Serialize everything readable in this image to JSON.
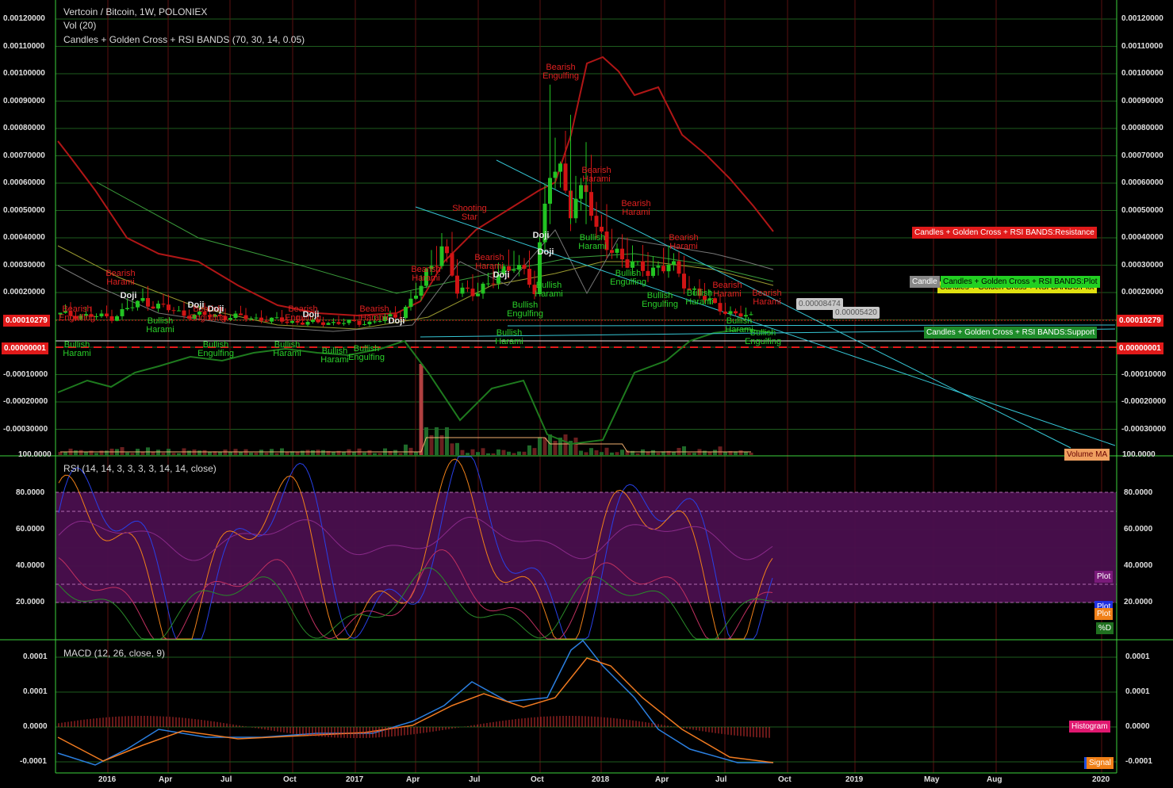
{
  "header": {
    "symbol_line": "Vertcoin / Bitcoin, 1W, POLONIEX",
    "vol_line": "Vol (20)",
    "indicator_line": "Candles + Golden Cross + RSI BANDS (70, 30, 14, 0.05)"
  },
  "main_axis": {
    "ticks": [
      "0.00120000",
      "0.00110000",
      "0.00100000",
      "0.00090000",
      "0.00080000",
      "0.00070000",
      "0.00060000",
      "0.00050000",
      "0.00040000",
      "0.00030000",
      "0.00020000",
      "0.00010000",
      "0.00000000",
      "-0.00010000",
      "-0.00020000",
      "-0.00030000"
    ],
    "left_ticks": [
      "0.00120000",
      "0.00110000",
      "0.00100000",
      "0.00090000",
      "0.00080000",
      "0.00070000",
      "0.00060000",
      "0.00050000",
      "0.00040000",
      "0.00030000",
      "0.00020000",
      "0.00010000",
      "-0.00010000",
      "-0.00020000",
      "-0.00030000"
    ],
    "current_price": "0.00010279",
    "zero_value": "0.00000001",
    "bottom_label": "100.0000"
  },
  "price_labels": {
    "resistance": "Candles + Golden Cross + RSI BANDS:Resistance",
    "plot": "Candles + Golden Cross + RSI BANDS:Plot",
    "plot_short": "Candle",
    "support": "Candles + Golden Cross + RSI BANDS:Support",
    "volume_ma": "Volume MA",
    "callout_1": "0.00008474",
    "callout_2": "0.00005420"
  },
  "patterns": [
    {
      "text": "Bearish Engulfing",
      "kind": "bear"
    },
    {
      "text": "Bullish Harami",
      "kind": "bull"
    },
    {
      "text": "Bearish Harami",
      "kind": "bear"
    },
    {
      "text": "Bullish Engulfing",
      "kind": "bull"
    },
    {
      "text": "Shooting Star",
      "kind": "bear"
    },
    {
      "text": "Doji",
      "kind": "doji"
    }
  ],
  "rsi": {
    "title": "RSI (14, 14, 3, 3, 3, 3, 14, 14, close)",
    "ticks": [
      "80.0000",
      "60.0000",
      "40.0000",
      "20.0000"
    ],
    "labels": [
      "Plot",
      "Plot",
      "Plot",
      "%D"
    ]
  },
  "macd": {
    "title": "MACD (12, 26, close, 9)",
    "ticks": [
      "0.0001",
      "0.0001",
      "0.0000",
      "-0.0001"
    ],
    "labels": [
      "Histogram",
      "Signal"
    ]
  },
  "time_axis": [
    "2016",
    "Apr",
    "Jul",
    "Oct",
    "2017",
    "Apr",
    "Jul",
    "Oct",
    "2018",
    "Apr",
    "Jul",
    "Oct",
    "2019",
    "May",
    "Aug",
    "2020"
  ],
  "colors": {
    "bull": "#22c322",
    "bear": "#d01414",
    "grid_v": "#5a1010",
    "grid_h": "#1e5c1e",
    "axis_line": "#3cd23c",
    "trend": "#36c7d6",
    "rsi_band": "#4a0f4e"
  }
}
